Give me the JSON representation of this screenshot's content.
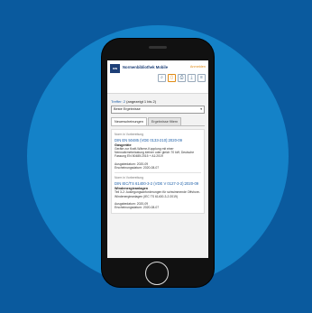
{
  "app": {
    "title": "Normenbibliothek Mobile",
    "login": "Anmelden",
    "logo": "DIN"
  },
  "toolbar": {
    "icons": [
      "search-icon",
      "list-icon",
      "print-icon",
      "download-icon",
      "menu-icon"
    ]
  },
  "results": {
    "label": "Treffer: 2",
    "shown": "(angezeigt 1 bis 2)"
  },
  "sort": {
    "selected": "Beste Ergebnisse",
    "caret": "▾"
  },
  "tabs": [
    {
      "label": "Neuerscheinungen",
      "active": true
    },
    {
      "label": "Ergebnisse filtern",
      "active": false
    }
  ],
  "items": [
    {
      "status": "Norm in Vorbereitung",
      "code": "DIN EN 50485 (VDE 0133-210):2020-09",
      "name": "Gasgeräte",
      "desc": "Geräte zur Kraft-Wärme-Kopplung mit einer Nennwärmebelastung kleiner oder gleich 70 kW; Deutsche Fassung EN 50485:2015 + A1:2019",
      "issue": "Ausgabedatum: 2020-09",
      "published": "Erscheinungsdatum: 2020-08-07"
    },
    {
      "status": "Norm in Vorbereitung",
      "code": "DIN IEC/TS 61400-3-2 (VDE V 0127-3-2):2020-09",
      "name": "Windenergieanlagen",
      "desc": "Teil 3-2: Auslegungsanforderungen für schwimmende Offshore-Windenergieanlagen (IEC TS 61400-3-2:2019)",
      "issue": "Ausgabedatum: 2020-09",
      "published": "Erscheinungsdatum: 2020-08-07"
    }
  ]
}
